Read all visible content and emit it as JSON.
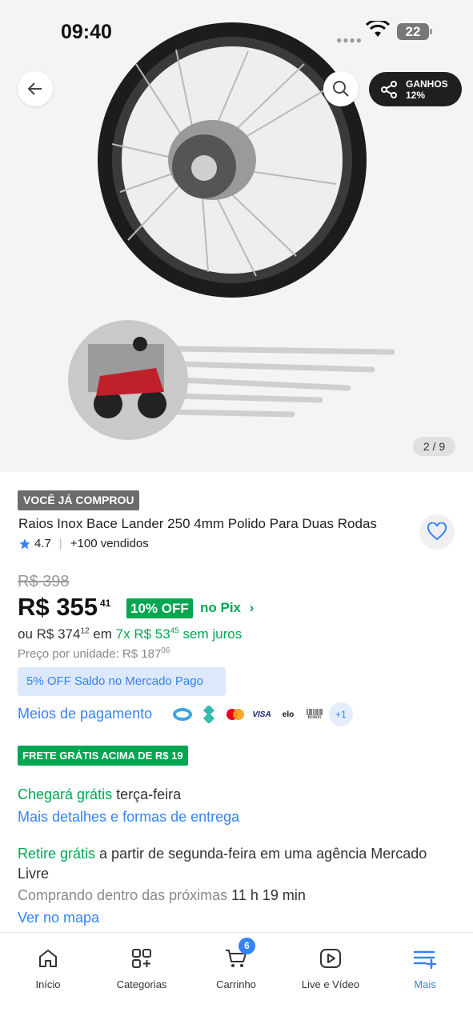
{
  "status_bar": {
    "time": "09:40",
    "battery": "22"
  },
  "header": {
    "share_label": "GANHOS",
    "share_percent": "12%"
  },
  "gallery": {
    "counter": "2 / 9"
  },
  "product": {
    "badge": "VOCÊ JÁ COMPROU",
    "title": "Raios Inox Bace Lander 250 4mm Polido Para Duas Rodas",
    "rating": "4.7",
    "sold": "+100 vendidos",
    "old_price": "R$ 398",
    "price_int": "R$ 355",
    "price_cents": "41",
    "discount": "10% OFF",
    "pix_label": "no Pix",
    "installment_prefix": "ou R$ 374",
    "installment_prefix_cents": "12",
    "installment_mid": " em ",
    "installment_value": "7x R$ 53",
    "installment_value_cents": "45",
    "installment_suffix": " sem juros",
    "unit_price": "Preço por unidade: R$ 187",
    "unit_price_cents": "06",
    "saldo_promo": "5% OFF Saldo no Mercado Pago",
    "payment_link": "Meios de pagamento",
    "payment_more": "+1",
    "boleto_label": "Boleto"
  },
  "shipping": {
    "free_badge": "FRETE GRÁTIS ACIMA DE R$ 19",
    "arrival_green": "Chegará grátis",
    "arrival_day": " terça-feira",
    "details_link": "Mais detalhes e formas de entrega",
    "pickup_green": "Retire grátis",
    "pickup_text": " a partir de segunda-feira em uma agência Mercado",
    "pickup_text2": "Livre",
    "buy_within": "Comprando dentro das próximas ",
    "buy_time": "11 h 19 min",
    "map_link": "Ver no mapa"
  },
  "nav": {
    "items": [
      {
        "label": "Início",
        "icon": "home-icon"
      },
      {
        "label": "Categorias",
        "icon": "categories-icon"
      },
      {
        "label": "Carrinho",
        "icon": "cart-icon",
        "badge": "6"
      },
      {
        "label": "Live e Vídeo",
        "icon": "play-icon"
      },
      {
        "label": "Mais",
        "icon": "menu-plus-icon",
        "active": true
      }
    ]
  },
  "colors": {
    "accent": "#3483fa",
    "green": "#00a650",
    "badge_gray": "#6b6b6b"
  }
}
